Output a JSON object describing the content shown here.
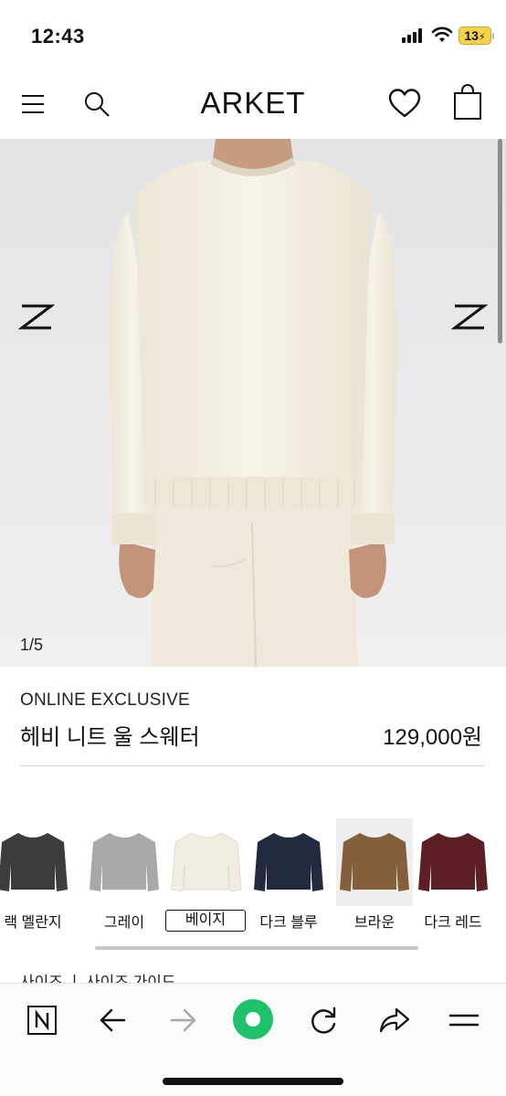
{
  "status_bar": {
    "time": "12:43",
    "battery": "13"
  },
  "header": {
    "brand": "ARKET"
  },
  "hero": {
    "slide_counter": "1/5",
    "current_slide": 1,
    "total_slides": 5
  },
  "product": {
    "badge": "ONLINE EXCLUSIVE",
    "name": "헤비 니트 울 스웨터",
    "price": "129,000원"
  },
  "colors": {
    "selected": "베이지",
    "options": [
      {
        "label": "랙 멜란지",
        "color": "#3c3c3c"
      },
      {
        "label": "그레이",
        "color": "#a9a9a9"
      },
      {
        "label": "베이지",
        "color": "#f1ede2"
      },
      {
        "label": "다크 블루",
        "color": "#222b3d"
      },
      {
        "label": "브라운",
        "color": "#835f3b"
      },
      {
        "label": "다크 레드",
        "color": "#5c1f26"
      }
    ]
  },
  "size_section_peek": "사이즈 ㅣ 사이즈 가이드",
  "toolbar": {
    "accent_color": "#1ec26b",
    "icons": [
      "naver-icon",
      "back-arrow-icon",
      "forward-arrow-icon",
      "green-dot-icon",
      "refresh-icon",
      "share-icon",
      "menu-icon"
    ]
  }
}
